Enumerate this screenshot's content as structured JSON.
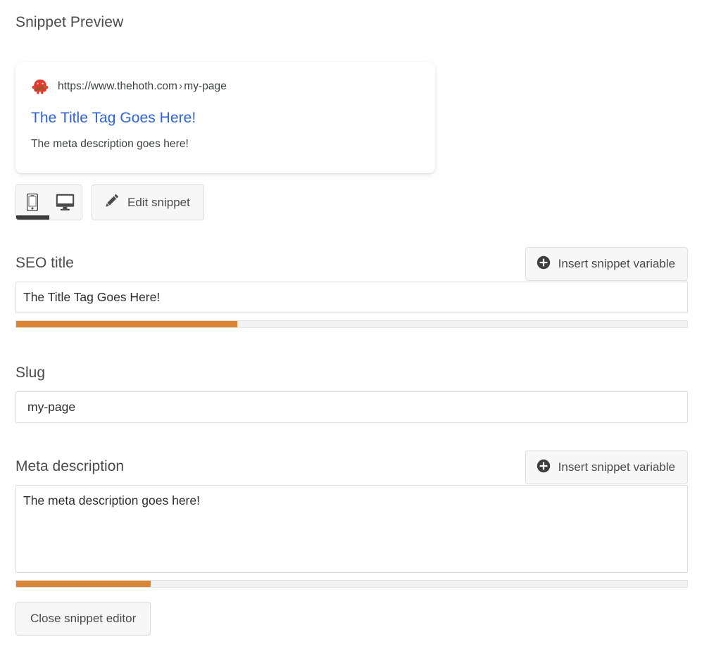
{
  "heading": "Snippet Preview",
  "preview": {
    "favicon_name": "thehoth-mascot-favicon",
    "url": "https://www.thehoth.com",
    "url_separator": "›",
    "url_path": "my-page",
    "title": "The Title Tag Goes Here!",
    "description": "The meta description goes here!"
  },
  "toolbar": {
    "mobile_label": "Mobile preview",
    "desktop_label": "Desktop preview",
    "active_device": "mobile",
    "edit_snippet_label": "Edit snippet"
  },
  "fields": {
    "seo_title": {
      "label": "SEO title",
      "value": "The Title Tag Goes Here!",
      "placeholder": "",
      "insert_variable_label": "Insert snippet variable",
      "progress_percent": 33
    },
    "slug": {
      "label": "Slug",
      "value": "my-page",
      "placeholder": ""
    },
    "meta_description": {
      "label": "Meta description",
      "value": "The meta description goes here!",
      "placeholder": "",
      "insert_variable_label": "Insert snippet variable",
      "progress_percent": 20
    }
  },
  "footer": {
    "close_label": "Close snippet editor"
  },
  "colors": {
    "progress_fill": "#dd8432",
    "progress_track": "#f3f3f3",
    "preview_title": "#2f62d8",
    "preview_text": "#3c4043",
    "heading_text": "#4b4b4b",
    "active_tab_indicator": "#3c3c3c",
    "favicon_red": "#e03a2f"
  }
}
